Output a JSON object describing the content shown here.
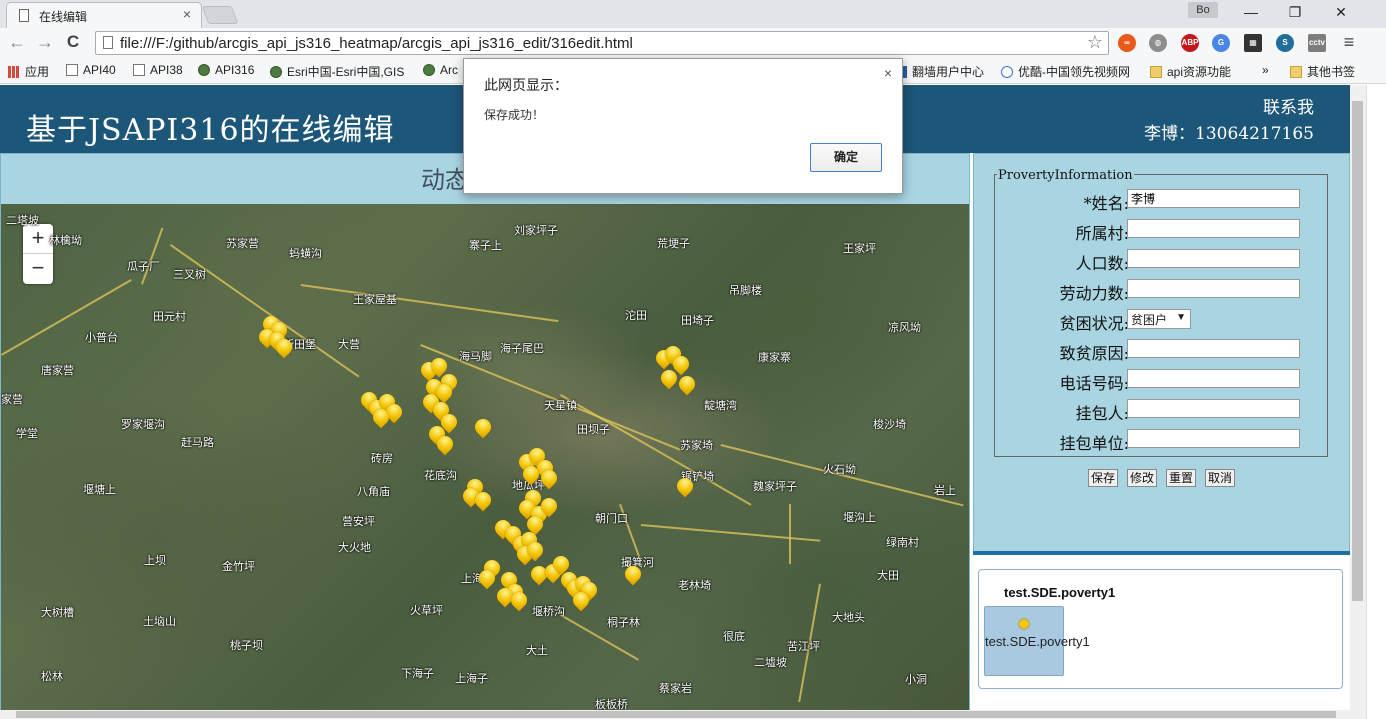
{
  "browser": {
    "tab_title": "在线编辑",
    "tab_close": "×",
    "profile": "Bo",
    "window_min": "—",
    "window_max": "❐",
    "window_close": "✕",
    "back": "←",
    "forward": "→",
    "reload": "C",
    "url": "file:///F:/github/arcgis_api_js316_heatmap/arcgis_api_js316_edit/316edit.html",
    "star": "☆",
    "menu": "≡",
    "extensions": [
      {
        "name": "infinity-icon",
        "label": "∞",
        "color": "#e8591a"
      },
      {
        "name": "globe-icon",
        "label": "◍",
        "color": "#8d8d8d"
      },
      {
        "name": "adblock-icon",
        "label": "ABP",
        "color": "#c5161d"
      },
      {
        "name": "translate-icon",
        "label": "G",
        "color": "#4a86e8"
      },
      {
        "name": "film-icon",
        "label": "▦",
        "color": "#333333"
      },
      {
        "name": "s-icon",
        "label": "S",
        "color": "#1f6f9a"
      },
      {
        "name": "cctv-icon",
        "label": "cctv",
        "color": "#7d7d7d"
      }
    ]
  },
  "bookmarks": [
    {
      "label": "应用",
      "icon": "apps"
    },
    {
      "label": "API40",
      "icon": "page"
    },
    {
      "label": "API38",
      "icon": "page"
    },
    {
      "label": "API316",
      "icon": "globe"
    },
    {
      "label": "Esri中国-Esri中国,GIS",
      "icon": "globe"
    },
    {
      "label": "Arc",
      "icon": "globe"
    },
    {
      "label": "翻墙用户中心",
      "icon": "fq"
    },
    {
      "label": "优酷-中国领先视频网",
      "icon": "youku"
    },
    {
      "label": "api资源功能",
      "icon": "folder"
    },
    {
      "label": "»",
      "icon": "none"
    },
    {
      "label": "其他书签",
      "icon": "folder"
    }
  ],
  "page": {
    "title": "基于JSAPI316的在线编辑",
    "contact_line1": "联系我",
    "contact_line2": "李博：13064217165",
    "map_header": "动态"
  },
  "map": {
    "zoom_in": "+",
    "zoom_out": "−",
    "places": [
      {
        "t": "二塔坡"
      },
      {
        "t": "林檎坳"
      },
      {
        "t": "苏家营"
      },
      {
        "t": "蚂蟥沟"
      },
      {
        "t": "寨子上"
      },
      {
        "t": "刘家坪子"
      },
      {
        "t": "荒埂子"
      },
      {
        "t": "王家坪"
      },
      {
        "t": "瓜子厂"
      },
      {
        "t": "三叉树"
      },
      {
        "t": "吊脚楼"
      },
      {
        "t": "王家屋基"
      },
      {
        "t": "田元村"
      },
      {
        "t": "沱田"
      },
      {
        "t": "田埼子"
      },
      {
        "t": "凉风坳"
      },
      {
        "t": "小普台"
      },
      {
        "t": "新田堡"
      },
      {
        "t": "大营"
      },
      {
        "t": "海子尾巴"
      },
      {
        "t": "海马脚"
      },
      {
        "t": "康家寨"
      },
      {
        "t": "唐家营"
      },
      {
        "t": "天星镇"
      },
      {
        "t": "靛塘湾"
      },
      {
        "t": "家营"
      },
      {
        "t": "罗家堰沟"
      },
      {
        "t": "田坝子"
      },
      {
        "t": "梭沙埼"
      },
      {
        "t": "学堂"
      },
      {
        "t": "赶马路"
      },
      {
        "t": "苏家埼"
      },
      {
        "t": "砖房"
      },
      {
        "t": "花底沟"
      },
      {
        "t": "火石坳"
      },
      {
        "t": "八角庙"
      },
      {
        "t": "堰塘上"
      },
      {
        "t": "地瓜坪"
      },
      {
        "t": "魏家坪子"
      },
      {
        "t": "岩上"
      },
      {
        "t": "营安坪"
      },
      {
        "t": "朝门口"
      },
      {
        "t": "堰沟上"
      },
      {
        "t": "大火地"
      },
      {
        "t": "绿南村"
      },
      {
        "t": "上坝"
      },
      {
        "t": "金竹坪"
      },
      {
        "t": "撮箕河"
      },
      {
        "t": "大田"
      },
      {
        "t": "老林埼"
      },
      {
        "t": "大树槽"
      },
      {
        "t": "火草坪"
      },
      {
        "t": "堰桥沟"
      },
      {
        "t": "土垴山"
      },
      {
        "t": "桐子林"
      },
      {
        "t": "大地头"
      },
      {
        "t": "桃子坝"
      },
      {
        "t": "很底"
      },
      {
        "t": "苦江坪"
      },
      {
        "t": "大土"
      },
      {
        "t": "二墟坡"
      },
      {
        "t": "松林"
      },
      {
        "t": "下海子"
      },
      {
        "t": "上海子"
      },
      {
        "t": "蔡家岩"
      },
      {
        "t": "小洞"
      },
      {
        "t": "板板桥"
      },
      {
        "t": "锯铲埼"
      },
      {
        "t": "上海"
      }
    ]
  },
  "form": {
    "legend": "ProvertyInformation",
    "fields": [
      {
        "label": "*姓名:",
        "value": "李博"
      },
      {
        "label": "所属村:",
        "value": ""
      },
      {
        "label": "人口数:",
        "value": ""
      },
      {
        "label": "劳动力数:",
        "value": ""
      },
      {
        "label": "贫困状况:",
        "value": "贫困户"
      },
      {
        "label": "致贫原因:",
        "value": ""
      },
      {
        "label": "电话号码:",
        "value": ""
      },
      {
        "label": "挂包人:",
        "value": ""
      },
      {
        "label": "挂包单位:",
        "value": ""
      }
    ],
    "buttons": [
      "保存",
      "修改",
      "重置",
      "取消"
    ]
  },
  "layers": {
    "title": "test.SDE.poverty1",
    "item_label": "test.SDE.poverty1"
  },
  "dialog": {
    "title": "此网页显示：",
    "message": "保存成功！",
    "ok": "确定",
    "close": "×"
  }
}
